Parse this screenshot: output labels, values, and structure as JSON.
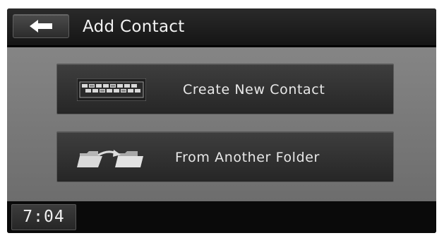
{
  "header": {
    "back_icon": "back-arrow-icon",
    "title": "Add Contact"
  },
  "menu": {
    "items": [
      {
        "label": "Create New Contact",
        "icon": "keyboard-icon"
      },
      {
        "label": "From Another Folder",
        "icon": "folder-transfer-icon"
      }
    ]
  },
  "status": {
    "clock": "7:04"
  },
  "colors": {
    "screen_bg": "#050505",
    "content_bg": "#7a7a7a",
    "button_bg": "#303030",
    "text": "#eeeeee"
  }
}
